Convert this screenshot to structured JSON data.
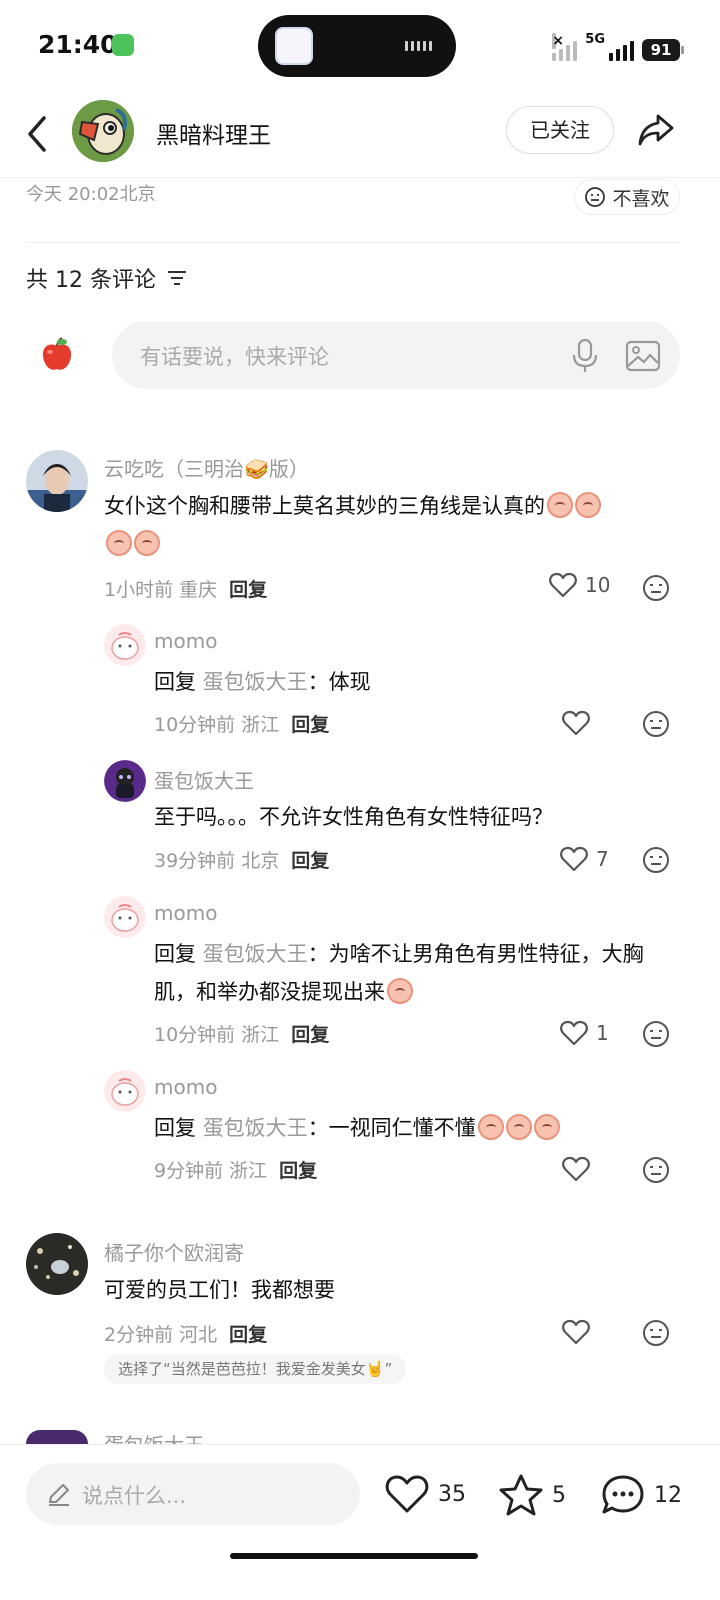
{
  "status_bar": {
    "time": "21:40",
    "network": "5G",
    "battery": "91"
  },
  "header": {
    "username": "黑暗料理王",
    "follow_label": "已关注"
  },
  "post_meta": {
    "time_location": "今天 20:02北京",
    "dislike_label": "不喜欢"
  },
  "comments_section": {
    "count_title": "共 12 条评论",
    "input_placeholder": "有话要说，快来评论"
  },
  "comments": [
    {
      "name": "云吃吃（三明治🥪版）",
      "text": "女仆这个胸和腰带上莫名其妙的三角线是认真的",
      "time_loc": "1小时前 重庆",
      "reply": "回复",
      "likes": "10",
      "replies": [
        {
          "name": "momo",
          "prefix": "回复",
          "reply_to": "蛋包饭大王",
          "text": "：体现",
          "time_loc": "10分钟前 浙江",
          "reply": "回复",
          "likes": ""
        },
        {
          "name": "蛋包饭大王",
          "text": "至于吗。。。不允许女性角色有女性特征吗？",
          "time_loc": "39分钟前 北京",
          "reply": "回复",
          "likes": "7"
        },
        {
          "name": "momo",
          "prefix": "回复",
          "reply_to": "蛋包饭大王",
          "text": "：为啥不让男角色有男性特征，大胸肌，和举办都没提现出来",
          "time_loc": "10分钟前 浙江",
          "reply": "回复",
          "likes": "1"
        },
        {
          "name": "momo",
          "prefix": "回复",
          "reply_to": "蛋包饭大王",
          "text": "：一视同仁懂不懂",
          "time_loc": "9分钟前 浙江",
          "reply": "回复",
          "likes": ""
        }
      ]
    },
    {
      "name": "橘子你个欧润寄",
      "text": "可爱的员工们！我都想要",
      "time_loc": "2分钟前 河北",
      "reply": "回复",
      "likes": "",
      "tag": "选择了“当然是芭芭拉！我爱金发美女🤘”"
    },
    {
      "name": "蛋包饭大王"
    }
  ],
  "bottom_bar": {
    "say_placeholder": "说点什么...",
    "likes": "35",
    "favorites": "5",
    "comments": "12"
  }
}
